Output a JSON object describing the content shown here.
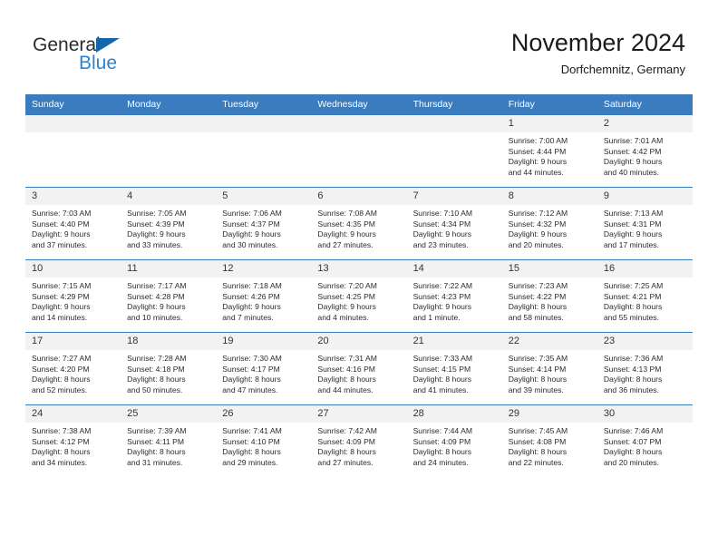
{
  "brand": {
    "name_part1": "General",
    "name_part2": "Blue",
    "triangle_color": "#1565ad",
    "blue_color": "#2a84d2"
  },
  "header": {
    "title": "November 2024",
    "subtitle": "Dorfchemnitz, Germany"
  },
  "theme": {
    "header_blue": "#3a7cbe",
    "daynum_gray": "#f2f2f2",
    "cell_white": "#ffffff"
  },
  "weekday_headers": [
    "Sunday",
    "Monday",
    "Tuesday",
    "Wednesday",
    "Thursday",
    "Friday",
    "Saturday"
  ],
  "weeks": [
    [
      {
        "day": "",
        "lines": []
      },
      {
        "day": "",
        "lines": []
      },
      {
        "day": "",
        "lines": []
      },
      {
        "day": "",
        "lines": []
      },
      {
        "day": "",
        "lines": []
      },
      {
        "day": "1",
        "lines": [
          "Sunrise: 7:00 AM",
          "Sunset: 4:44 PM",
          "Daylight: 9 hours",
          "and 44 minutes."
        ]
      },
      {
        "day": "2",
        "lines": [
          "Sunrise: 7:01 AM",
          "Sunset: 4:42 PM",
          "Daylight: 9 hours",
          "and 40 minutes."
        ]
      }
    ],
    [
      {
        "day": "3",
        "lines": [
          "Sunrise: 7:03 AM",
          "Sunset: 4:40 PM",
          "Daylight: 9 hours",
          "and 37 minutes."
        ]
      },
      {
        "day": "4",
        "lines": [
          "Sunrise: 7:05 AM",
          "Sunset: 4:39 PM",
          "Daylight: 9 hours",
          "and 33 minutes."
        ]
      },
      {
        "day": "5",
        "lines": [
          "Sunrise: 7:06 AM",
          "Sunset: 4:37 PM",
          "Daylight: 9 hours",
          "and 30 minutes."
        ]
      },
      {
        "day": "6",
        "lines": [
          "Sunrise: 7:08 AM",
          "Sunset: 4:35 PM",
          "Daylight: 9 hours",
          "and 27 minutes."
        ]
      },
      {
        "day": "7",
        "lines": [
          "Sunrise: 7:10 AM",
          "Sunset: 4:34 PM",
          "Daylight: 9 hours",
          "and 23 minutes."
        ]
      },
      {
        "day": "8",
        "lines": [
          "Sunrise: 7:12 AM",
          "Sunset: 4:32 PM",
          "Daylight: 9 hours",
          "and 20 minutes."
        ]
      },
      {
        "day": "9",
        "lines": [
          "Sunrise: 7:13 AM",
          "Sunset: 4:31 PM",
          "Daylight: 9 hours",
          "and 17 minutes."
        ]
      }
    ],
    [
      {
        "day": "10",
        "lines": [
          "Sunrise: 7:15 AM",
          "Sunset: 4:29 PM",
          "Daylight: 9 hours",
          "and 14 minutes."
        ]
      },
      {
        "day": "11",
        "lines": [
          "Sunrise: 7:17 AM",
          "Sunset: 4:28 PM",
          "Daylight: 9 hours",
          "and 10 minutes."
        ]
      },
      {
        "day": "12",
        "lines": [
          "Sunrise: 7:18 AM",
          "Sunset: 4:26 PM",
          "Daylight: 9 hours",
          "and 7 minutes."
        ]
      },
      {
        "day": "13",
        "lines": [
          "Sunrise: 7:20 AM",
          "Sunset: 4:25 PM",
          "Daylight: 9 hours",
          "and 4 minutes."
        ]
      },
      {
        "day": "14",
        "lines": [
          "Sunrise: 7:22 AM",
          "Sunset: 4:23 PM",
          "Daylight: 9 hours",
          "and 1 minute."
        ]
      },
      {
        "day": "15",
        "lines": [
          "Sunrise: 7:23 AM",
          "Sunset: 4:22 PM",
          "Daylight: 8 hours",
          "and 58 minutes."
        ]
      },
      {
        "day": "16",
        "lines": [
          "Sunrise: 7:25 AM",
          "Sunset: 4:21 PM",
          "Daylight: 8 hours",
          "and 55 minutes."
        ]
      }
    ],
    [
      {
        "day": "17",
        "lines": [
          "Sunrise: 7:27 AM",
          "Sunset: 4:20 PM",
          "Daylight: 8 hours",
          "and 52 minutes."
        ]
      },
      {
        "day": "18",
        "lines": [
          "Sunrise: 7:28 AM",
          "Sunset: 4:18 PM",
          "Daylight: 8 hours",
          "and 50 minutes."
        ]
      },
      {
        "day": "19",
        "lines": [
          "Sunrise: 7:30 AM",
          "Sunset: 4:17 PM",
          "Daylight: 8 hours",
          "and 47 minutes."
        ]
      },
      {
        "day": "20",
        "lines": [
          "Sunrise: 7:31 AM",
          "Sunset: 4:16 PM",
          "Daylight: 8 hours",
          "and 44 minutes."
        ]
      },
      {
        "day": "21",
        "lines": [
          "Sunrise: 7:33 AM",
          "Sunset: 4:15 PM",
          "Daylight: 8 hours",
          "and 41 minutes."
        ]
      },
      {
        "day": "22",
        "lines": [
          "Sunrise: 7:35 AM",
          "Sunset: 4:14 PM",
          "Daylight: 8 hours",
          "and 39 minutes."
        ]
      },
      {
        "day": "23",
        "lines": [
          "Sunrise: 7:36 AM",
          "Sunset: 4:13 PM",
          "Daylight: 8 hours",
          "and 36 minutes."
        ]
      }
    ],
    [
      {
        "day": "24",
        "lines": [
          "Sunrise: 7:38 AM",
          "Sunset: 4:12 PM",
          "Daylight: 8 hours",
          "and 34 minutes."
        ]
      },
      {
        "day": "25",
        "lines": [
          "Sunrise: 7:39 AM",
          "Sunset: 4:11 PM",
          "Daylight: 8 hours",
          "and 31 minutes."
        ]
      },
      {
        "day": "26",
        "lines": [
          "Sunrise: 7:41 AM",
          "Sunset: 4:10 PM",
          "Daylight: 8 hours",
          "and 29 minutes."
        ]
      },
      {
        "day": "27",
        "lines": [
          "Sunrise: 7:42 AM",
          "Sunset: 4:09 PM",
          "Daylight: 8 hours",
          "and 27 minutes."
        ]
      },
      {
        "day": "28",
        "lines": [
          "Sunrise: 7:44 AM",
          "Sunset: 4:09 PM",
          "Daylight: 8 hours",
          "and 24 minutes."
        ]
      },
      {
        "day": "29",
        "lines": [
          "Sunrise: 7:45 AM",
          "Sunset: 4:08 PM",
          "Daylight: 8 hours",
          "and 22 minutes."
        ]
      },
      {
        "day": "30",
        "lines": [
          "Sunrise: 7:46 AM",
          "Sunset: 4:07 PM",
          "Daylight: 8 hours",
          "and 20 minutes."
        ]
      }
    ]
  ]
}
